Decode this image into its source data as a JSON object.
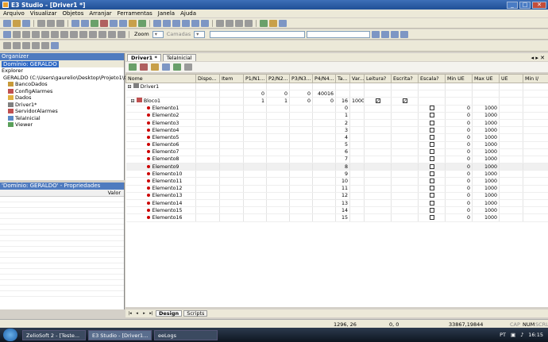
{
  "window": {
    "title": "E3 Studio - [Driver1 *]",
    "minimize": "_",
    "maximize": "□",
    "close": "✕"
  },
  "menu": [
    "Arquivo",
    "Visualizar",
    "Objetos",
    "Arranjar",
    "Ferramentas",
    "Janela",
    "Ajuda"
  ],
  "toolbar": {
    "zoom_label": "Zoom",
    "layers_label": "Camadas"
  },
  "organizer": {
    "title": "Organizer",
    "domain_tab": "Domínio: GERALDO",
    "explorer_label": "Explorer",
    "tree": [
      {
        "label": "GERALDO (C:\\Users\\gaurelio\\Desktop\\Projeto1\\GER",
        "depth": 0,
        "icon": "domain-icon"
      },
      {
        "label": "BancoDados",
        "depth": 1,
        "icon": "database-icon"
      },
      {
        "label": "ConfigAlarmes",
        "depth": 1,
        "icon": "alarm-icon"
      },
      {
        "label": "Dados",
        "depth": 1,
        "icon": "folder-icon"
      },
      {
        "label": "Driver1*",
        "depth": 1,
        "icon": "driver-icon"
      },
      {
        "label": "ServidorAlarmes",
        "depth": 1,
        "icon": "alarm-server-icon"
      },
      {
        "label": "TelaInicial",
        "depth": 1,
        "icon": "screen-icon"
      },
      {
        "label": "Viewer",
        "depth": 1,
        "icon": "viewer-icon"
      }
    ]
  },
  "properties": {
    "title": "'Domínio: GERALDO' - Propriedades",
    "value_header": "Valor"
  },
  "doc_tabs": [
    "Driver1 *",
    "TelaInicial"
  ],
  "grid": {
    "columns": [
      "Nome",
      "Dispo...",
      "Item",
      "P1/N1...",
      "P2/N2...",
      "P3/N3...",
      "P4/N4...",
      "Ta...",
      "Var...",
      "Leitura?",
      "Escrita?",
      "Escala?",
      "Min UE",
      "Max UE",
      "UE",
      "Min I/"
    ],
    "driver_row": {
      "name": "Driver1"
    },
    "block_row": {
      "name": "Bloco1",
      "p1": "1",
      "p2": "1",
      "p3": "0",
      "p4": "0",
      "ta": "16",
      "var": "1000"
    },
    "block_header": {
      "p1": "0",
      "p2": "0",
      "p3": "0",
      "p4": "40016"
    },
    "elements": [
      {
        "name": "Elemento1",
        "idx": "0",
        "min": "0",
        "max": "1000"
      },
      {
        "name": "Elemento2",
        "idx": "1",
        "min": "0",
        "max": "1000"
      },
      {
        "name": "Elemento3",
        "idx": "2",
        "min": "0",
        "max": "1000"
      },
      {
        "name": "Elemento4",
        "idx": "3",
        "min": "0",
        "max": "1000"
      },
      {
        "name": "Elemento5",
        "idx": "4",
        "min": "0",
        "max": "1000"
      },
      {
        "name": "Elemento6",
        "idx": "5",
        "min": "0",
        "max": "1000"
      },
      {
        "name": "Elemento7",
        "idx": "6",
        "min": "0",
        "max": "1000"
      },
      {
        "name": "Elemento8",
        "idx": "7",
        "min": "0",
        "max": "1000"
      },
      {
        "name": "Elemento9",
        "idx": "8",
        "min": "0",
        "max": "1000"
      },
      {
        "name": "Elemento10",
        "idx": "9",
        "min": "0",
        "max": "1000"
      },
      {
        "name": "Elemento11",
        "idx": "10",
        "min": "0",
        "max": "1000"
      },
      {
        "name": "Elemento12",
        "idx": "11",
        "min": "0",
        "max": "1000"
      },
      {
        "name": "Elemento13",
        "idx": "12",
        "min": "0",
        "max": "1000"
      },
      {
        "name": "Elemento14",
        "idx": "13",
        "min": "0",
        "max": "1000"
      },
      {
        "name": "Elemento15",
        "idx": "14",
        "min": "0",
        "max": "1000"
      },
      {
        "name": "Elemento16",
        "idx": "15",
        "min": "0",
        "max": "1000"
      }
    ]
  },
  "bottom_tabs": [
    "Design",
    "Scripts"
  ],
  "status": {
    "coords": "1296, 26",
    "size": "0, 0",
    "world": "33867,19844",
    "caps": "CAP",
    "num": "NUM",
    "scrl": "SCRL"
  },
  "taskbar": {
    "tasks": [
      "ZelioSoft 2 - [Teste...",
      "E3 Studio - [Driver1...",
      "eeLogs"
    ],
    "lang": "PT",
    "clock": "16:15"
  },
  "colors": {
    "titlebar": "#1f4f96",
    "selection": "#316ac5"
  }
}
